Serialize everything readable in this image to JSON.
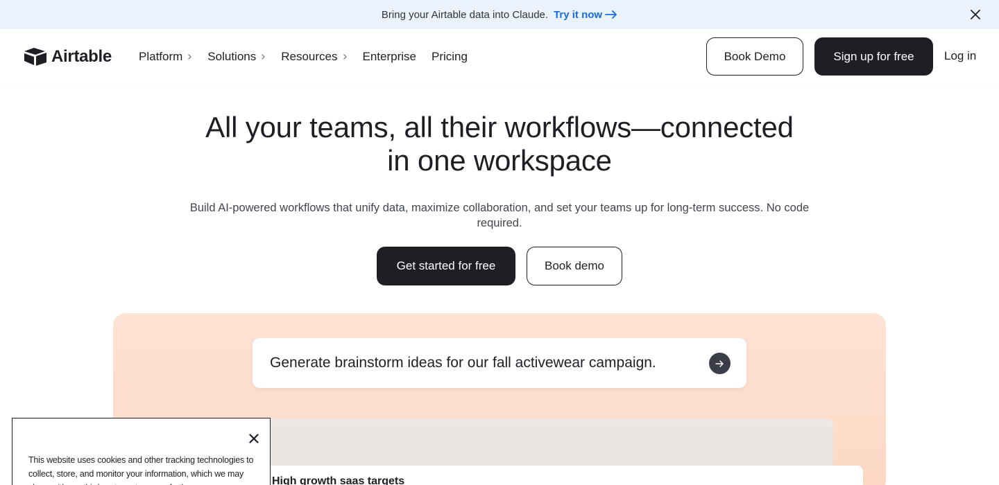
{
  "banner": {
    "text": "Bring your Airtable data into Claude.",
    "link_label": "Try it now"
  },
  "header": {
    "logo_text": "Airtable",
    "nav": [
      {
        "label": "Platform",
        "has_chevron": true
      },
      {
        "label": "Solutions",
        "has_chevron": true
      },
      {
        "label": "Resources",
        "has_chevron": true
      },
      {
        "label": "Enterprise",
        "has_chevron": false
      },
      {
        "label": "Pricing",
        "has_chevron": false
      }
    ],
    "book_demo_label": "Book Demo",
    "signup_label": "Sign up for free",
    "login_label": "Log in"
  },
  "hero": {
    "title_line1": "All your teams, all their workflows—connected",
    "title_line2": "in one workspace",
    "subtitle": "Build AI-powered workflows that unify data, maximize collaboration, and set your teams up for long-term success. No code required.",
    "cta_primary": "Get started for free",
    "cta_secondary": "Book demo"
  },
  "showcase": {
    "prompt": "Generate brainstorm ideas for our fall activewear campaign.",
    "preview_title": "High growth saas targets"
  },
  "cookie": {
    "text": "This website uses cookies and other tracking technologies to collect, store, and monitor your information, which we may share with our third-party partners, as further"
  },
  "colors": {
    "brand_dark": "#1d1f25",
    "link_blue": "#166ee1",
    "banner_bg": "#eaf2fd",
    "showcase_bg": "#fdd8c4"
  }
}
